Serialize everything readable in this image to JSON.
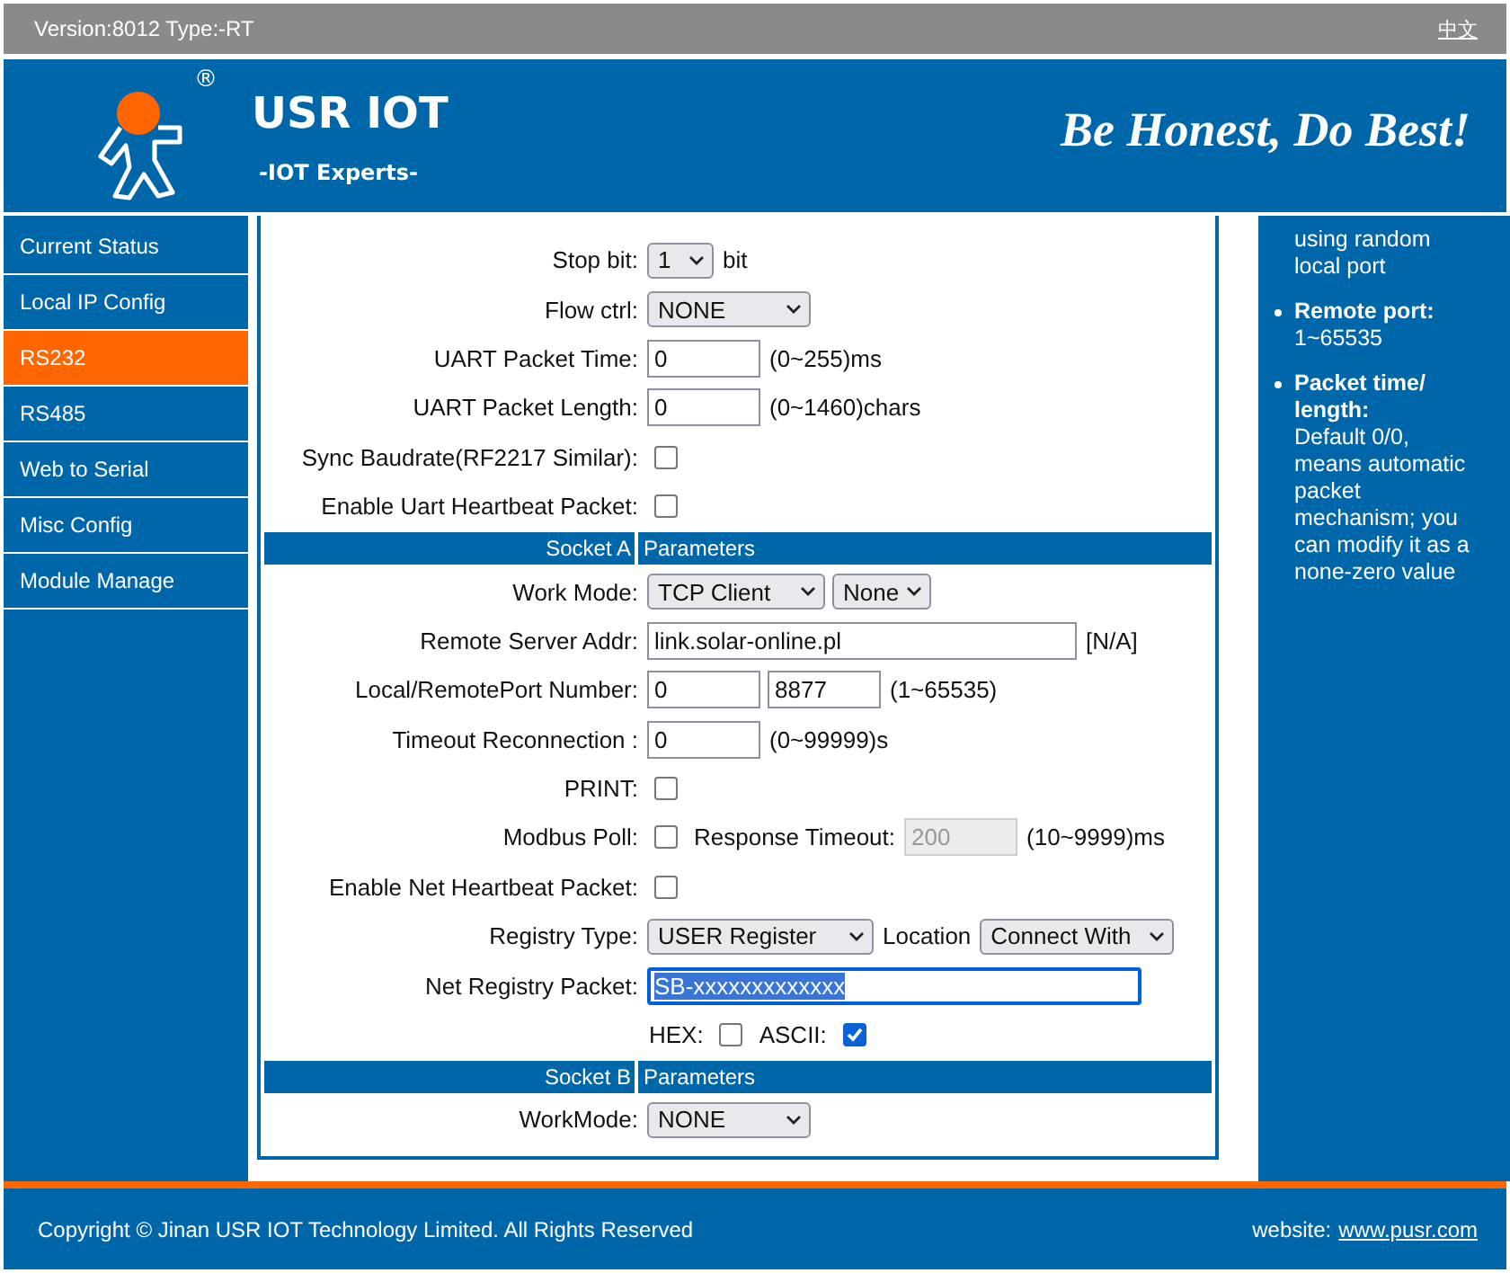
{
  "top_bar": {
    "version": "Version:8012 Type:-RT",
    "language_link": "中文"
  },
  "header": {
    "registered_mark": "®",
    "brand": "USR IOT",
    "subtitle": "-IOT Experts-",
    "slogan": "Be Honest, Do Best!"
  },
  "sidebar": {
    "items": [
      {
        "label": "Current Status",
        "selected": false
      },
      {
        "label": "Local IP Config",
        "selected": false
      },
      {
        "label": "RS232",
        "selected": true
      },
      {
        "label": "RS485",
        "selected": false
      },
      {
        "label": "Web to Serial",
        "selected": false
      },
      {
        "label": "Misc Config",
        "selected": false
      },
      {
        "label": "Module Manage",
        "selected": false
      }
    ]
  },
  "form": {
    "rows": [
      {
        "kind": "field",
        "label": "Stop bit:",
        "controls": [
          {
            "kind": "select",
            "value": "1"
          },
          {
            "kind": "text",
            "text": "bit"
          }
        ]
      },
      {
        "kind": "field",
        "label": "Flow ctrl:",
        "controls": [
          {
            "kind": "select",
            "value": "NONE"
          }
        ]
      },
      {
        "kind": "field",
        "label": "UART Packet Time:",
        "controls": [
          {
            "kind": "input",
            "value": "0",
            "disabled": false,
            "focused": false
          },
          {
            "kind": "text",
            "text": "(0~255)ms"
          }
        ]
      },
      {
        "kind": "field",
        "label": "UART Packet Length:",
        "controls": [
          {
            "kind": "input",
            "value": "0",
            "disabled": false,
            "focused": false
          },
          {
            "kind": "text",
            "text": "(0~1460)chars"
          }
        ]
      },
      {
        "kind": "field",
        "label": "Sync Baudrate(RF2217 Similar):",
        "controls": [
          {
            "kind": "checkbox",
            "checked": false
          }
        ]
      },
      {
        "kind": "field",
        "label": "Enable Uart Heartbeat Packet:",
        "controls": [
          {
            "kind": "checkbox",
            "checked": false
          }
        ]
      },
      {
        "kind": "section",
        "label": "Socket A",
        "title": "Parameters"
      },
      {
        "kind": "field",
        "label": "Work Mode:",
        "controls": [
          {
            "kind": "select",
            "value": "TCP Client"
          },
          {
            "kind": "select",
            "value": "None"
          }
        ]
      },
      {
        "kind": "field",
        "label": "Remote Server Addr:",
        "controls": [
          {
            "kind": "input",
            "value": "link.solar-online.pl",
            "disabled": false,
            "focused": false
          },
          {
            "kind": "text",
            "text": "[N/A]"
          }
        ]
      },
      {
        "kind": "field",
        "label": "Local/RemotePort Number:",
        "controls": [
          {
            "kind": "input",
            "value": "0",
            "disabled": false,
            "focused": false
          },
          {
            "kind": "input",
            "value": "8877",
            "disabled": false,
            "focused": false
          },
          {
            "kind": "text",
            "text": "(1~65535)"
          }
        ]
      },
      {
        "kind": "field",
        "label": "Timeout Reconnection :",
        "controls": [
          {
            "kind": "input",
            "value": "0",
            "disabled": false,
            "focused": false
          },
          {
            "kind": "text",
            "text": "(0~99999)s"
          }
        ]
      },
      {
        "kind": "field",
        "label": "PRINT:",
        "controls": [
          {
            "kind": "checkbox",
            "checked": false
          }
        ]
      },
      {
        "kind": "field",
        "label": "Modbus Poll:",
        "controls": [
          {
            "kind": "checkbox",
            "checked": false
          },
          {
            "kind": "text",
            "text": "Response Timeout:"
          },
          {
            "kind": "input",
            "value": "200",
            "disabled": true,
            "focused": false
          },
          {
            "kind": "text",
            "text": "(10~9999)ms"
          }
        ]
      },
      {
        "kind": "field",
        "label": "Enable Net Heartbeat Packet:",
        "controls": [
          {
            "kind": "checkbox",
            "checked": false
          }
        ]
      },
      {
        "kind": "field",
        "label": "Registry Type:",
        "controls": [
          {
            "kind": "select",
            "value": "USER Register"
          },
          {
            "kind": "text",
            "text": "Location"
          },
          {
            "kind": "select",
            "value": "Connect With"
          }
        ]
      },
      {
        "kind": "field",
        "label": "Net Registry Packet:",
        "controls": [
          {
            "kind": "input",
            "value": "SB-xxxxxxxxxxxxx",
            "disabled": false,
            "focused": true
          }
        ]
      },
      {
        "kind": "field",
        "controls": [
          {
            "kind": "text",
            "text": "HEX:"
          },
          {
            "kind": "checkbox",
            "checked": false
          },
          {
            "kind": "text",
            "text": "ASCII:"
          },
          {
            "kind": "checkbox",
            "checked": true
          }
        ]
      },
      {
        "kind": "section",
        "label": "Socket B",
        "title": "Parameters"
      },
      {
        "kind": "field",
        "label": "WorkMode:",
        "controls": [
          {
            "kind": "select",
            "value": "NONE"
          }
        ]
      }
    ]
  },
  "help": {
    "items": [
      {
        "text": "using random local port",
        "bullet": false
      },
      {
        "title": "Remote port:",
        "text": "1~65535",
        "bullet": true
      },
      {
        "title": "Packet time/ length:",
        "text": "Default 0/0, means automatic packet mechanism; you can modify it as a none-zero value",
        "bullet": true
      }
    ]
  },
  "footer": {
    "copyright": "Copyright © Jinan USR IOT Technology Limited. All Rights Reserved",
    "website_label": "website:",
    "website_link": "www.pusr.com"
  }
}
